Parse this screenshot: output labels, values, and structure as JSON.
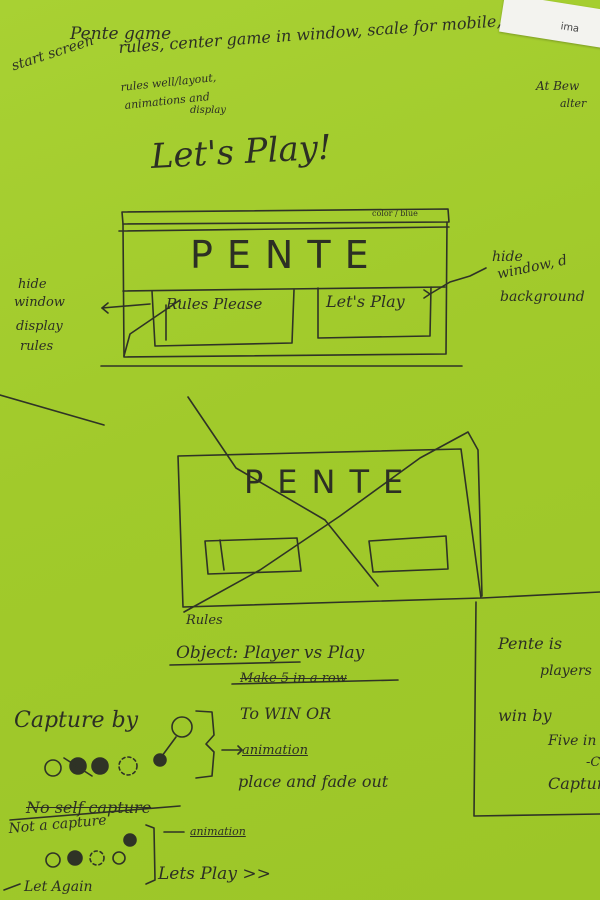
{
  "notes": {
    "corner_text": "ima",
    "top_title": "Pente game",
    "top_start": "start screen",
    "top_list": "rules, center game in window, scale for mobile,",
    "top_sub1": "rules well/layout,",
    "top_sub2": "animations and",
    "top_sub3": "display",
    "top_right1": "At Bew",
    "top_right2": "alter",
    "lets_play_heading": "Let's Play!",
    "sketch1_corner": "color / blue",
    "sketch1_title": "PENTE",
    "sketch1_btn_left": "Rules Please",
    "sketch1_btn_right": "Let's Play",
    "left_note1": "hide",
    "left_note2": "window",
    "left_note3": "display",
    "left_note4": "rules",
    "right_note1": "hide",
    "right_note2": "window, d",
    "right_note3": "background",
    "sketch2_title": "PENTE",
    "rules_label": "Rules",
    "rules_line1": "Object: Player vs Play",
    "rules_line2": "Make 5 in a row",
    "rules_line3": "To WIN OR",
    "capture_by": "Capture by",
    "animation1": "animation",
    "place_fade": "place and fade out",
    "no_self": "No self capture",
    "not_capture": "Not a capture",
    "animation2": "animation",
    "lets_play2": "Lets Play >>",
    "bottom_left": "Let Again",
    "right_box1": "Pente is",
    "right_box2": "players",
    "right_box3": "win by",
    "right_box4": "Five in",
    "right_box5": "-C",
    "right_box6": "Captur"
  }
}
